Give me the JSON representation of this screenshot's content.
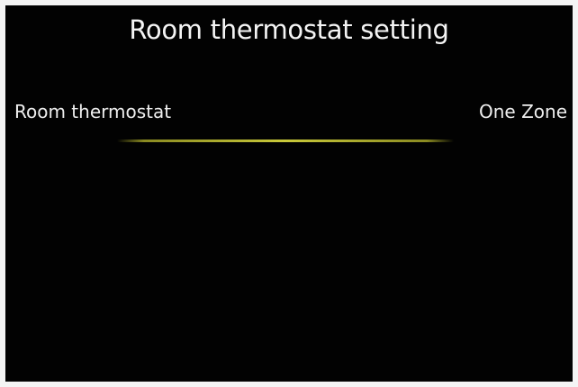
{
  "header": {
    "title": "Room thermostat setting"
  },
  "setting": {
    "label": "Room thermostat",
    "value": "One Zone"
  },
  "colors": {
    "background": "#020202",
    "text": "#f2f2f2",
    "accent_line": "#c9c93a"
  }
}
